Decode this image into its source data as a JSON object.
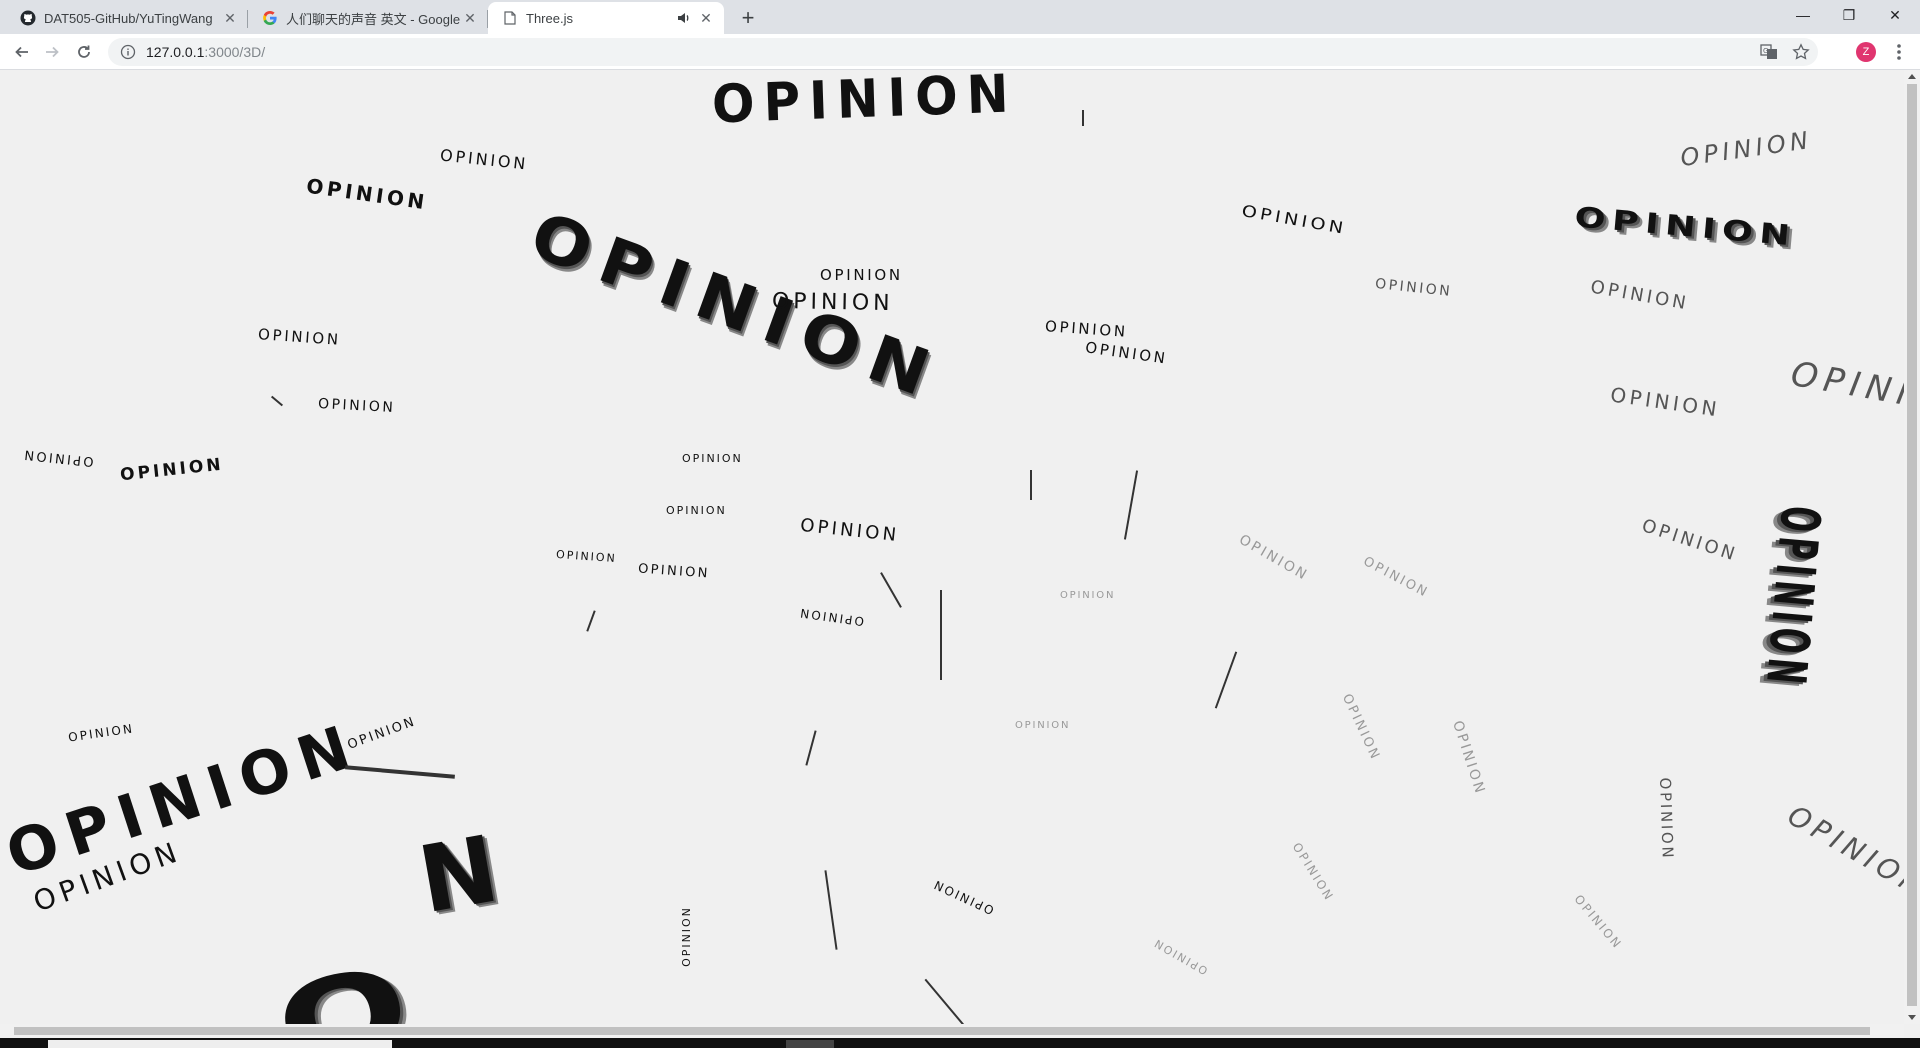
{
  "browser": {
    "tabs": [
      {
        "title": "DAT505-GitHub/YuTingWang",
        "favicon": "github-icon",
        "active": false
      },
      {
        "title": "人们聊天的声音 英文 - Google 搜",
        "favicon": "google-icon",
        "active": false
      },
      {
        "title": "Three.js",
        "favicon": "page-icon",
        "active": true,
        "audio": true
      }
    ],
    "new_tab_symbol": "+",
    "window_controls": {
      "minimize": "—",
      "maximize": "❐",
      "close": "✕"
    },
    "url_host": "127.0.0.1",
    "url_path": ":3000/3D/",
    "avatar_initial": "Z"
  },
  "scene": {
    "word": "OPINION",
    "fragment_n": "N",
    "fragment_o": "O",
    "background": "#f0f0f0",
    "text_color": "#111111"
  }
}
